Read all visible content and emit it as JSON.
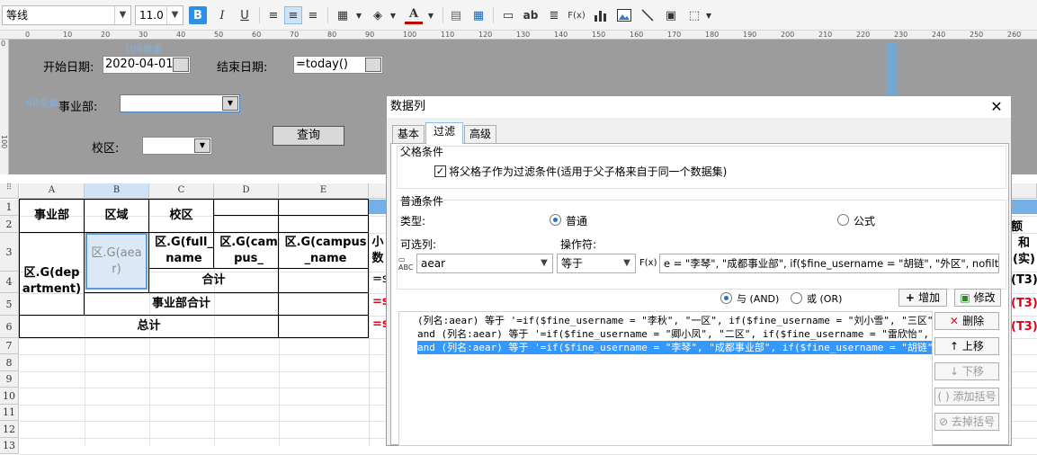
{
  "toolbar": {
    "font_name": "等线",
    "font_size": "11.0",
    "bold": "B",
    "italic": "I",
    "underline": "U",
    "text_format": "ab",
    "formula": "F(x)"
  },
  "ruler": {
    "top_ticks": [
      "0",
      "10",
      "20",
      "30",
      "40",
      "50",
      "60",
      "70",
      "80",
      "90",
      "100",
      "110",
      "120",
      "130",
      "140",
      "150",
      "160",
      "170",
      "180",
      "190",
      "200",
      "210",
      "220",
      "230",
      "240",
      "250",
      "260"
    ],
    "left_ticks": [
      "0",
      "100"
    ]
  },
  "design": {
    "dim_width": "106像素",
    "dim_height": "68像素",
    "start_label": "开始日期:",
    "start_value": "2020-04-01",
    "end_label": "结束日期:",
    "end_value": "=today()",
    "biz_label": "事业部:",
    "campus_label": "校区:",
    "query_button": "查询"
  },
  "grid": {
    "col_headers": [
      "A",
      "B",
      "C",
      "D",
      "E"
    ],
    "row_headers": [
      "1",
      "2",
      "3",
      "4",
      "5",
      "6",
      "7",
      "8",
      "9",
      "10",
      "11",
      "12",
      "13"
    ],
    "a1": "事业部",
    "b1": "区域",
    "c1": "校区",
    "a3": "区.G(department)",
    "b3": "区.G(aear)",
    "c3": "区.G(full_name",
    "d3": "区.G(campus_",
    "e3": "区.G(campus_name",
    "subtotal": "合计",
    "biz_total": "事业部合计",
    "grand_total": "总计",
    "f3": "小数",
    "f_eq": "=s",
    "right_h": "额",
    "right_r3": "和(实)",
    "right_t3": "(T3)"
  },
  "dialog": {
    "title": "数据列",
    "tabs": [
      "基本",
      "过滤",
      "高级"
    ],
    "parent_group": "父格条件",
    "parent_checkbox": "将父格子作为过滤条件(适用于父子格来自于同一个数据集)",
    "normal_group": "普通条件",
    "type_label": "类型:",
    "type_normal": "普通",
    "type_formula": "公式",
    "column_label": "可选列:",
    "column_value": "aear",
    "op_label": "操作符:",
    "op_value": "等于",
    "fx": "F(x)",
    "value_text": "e = \"李琴\", \"成都事业部\", if($fine_username = \"胡链\", \"外区\", nofilter))",
    "and_label": "与 (AND)",
    "or_label": "或 (OR)",
    "add_button": "增加",
    "modify_button": "修改",
    "delete_button": "删除",
    "up_button": "上移",
    "down_button": "下移",
    "add_bracket_button": "添加括号",
    "remove_bracket_button": "去掉括号",
    "conditions": [
      "(列名:aear) 等于 '=if($fine_username = \"李秋\", \"一区\", if($fine_username = \"刘小雪\", \"三区\", nofilter))'",
      "and (列名:aear) 等于 '=if($fine_username = \"卿小凤\", \"二区\", if($fine_username = \"雷欣怡\", \"川贵\", nofilter))'",
      "and (列名:aear) 等于 '=if($fine_username = \"李琴\", \"成都事业部\", if($fine_username = \"胡链\", \"外区\", nofilter))'"
    ]
  },
  "colors": {
    "accent": "#3399ff",
    "formula_red": "#e0001b",
    "highlight_col": "#73b0e8"
  }
}
